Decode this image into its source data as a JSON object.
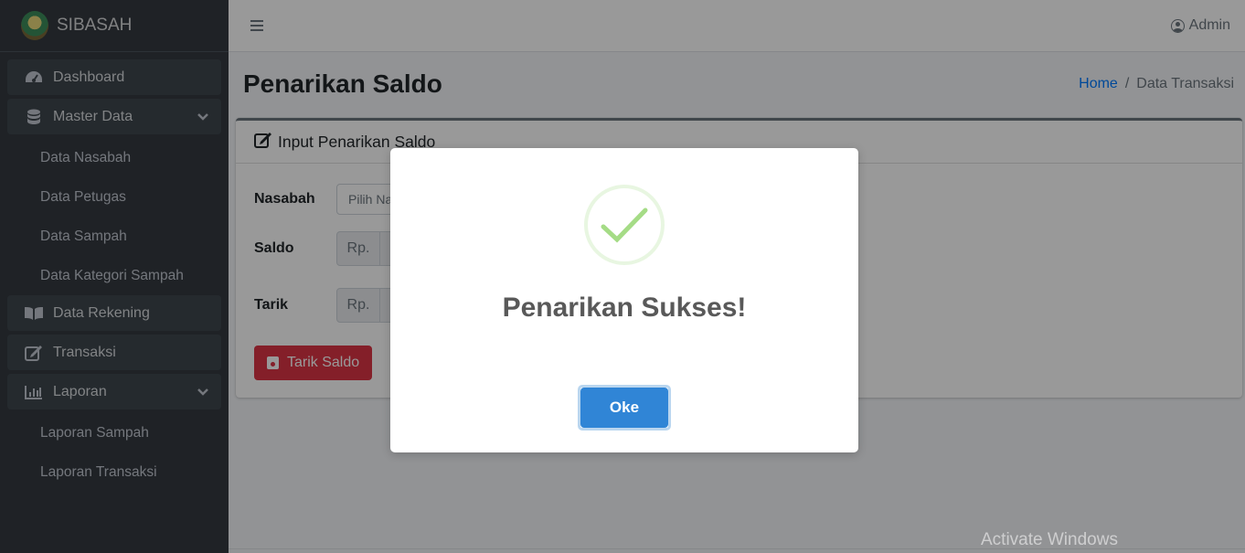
{
  "brand": {
    "name": "SIBASAH"
  },
  "sidebar": {
    "items": [
      {
        "label": "Dashboard",
        "icon": "tachometer-icon"
      },
      {
        "label": "Master Data",
        "icon": "database-icon",
        "expanded": true,
        "children": [
          "Data Nasabah",
          "Data Petugas",
          "Data Sampah",
          "Data Kategori Sampah"
        ]
      },
      {
        "label": "Data Rekening",
        "icon": "book-icon"
      },
      {
        "label": "Transaksi",
        "icon": "edit-icon"
      },
      {
        "label": "Laporan",
        "icon": "chart-icon",
        "expanded": true,
        "children": [
          "Laporan Sampah",
          "Laporan Transaksi"
        ]
      }
    ]
  },
  "header": {
    "user": "Admin"
  },
  "page": {
    "title": "Penarikan Saldo",
    "breadcrumb": {
      "home": "Home",
      "separator": "/",
      "current": "Data Transaksi"
    }
  },
  "card": {
    "title": "Input Penarikan Saldo",
    "nasabah": {
      "label": "Nasabah",
      "placeholder": "Pilih Na"
    },
    "saldo": {
      "label": "Saldo",
      "prefix": "Rp."
    },
    "tarik": {
      "label": "Tarik",
      "prefix": "Rp."
    },
    "submit_label": "Tarik Saldo"
  },
  "modal": {
    "title": "Penarikan Sukses!",
    "ok_label": "Oke",
    "icon": "success-check-icon",
    "accent": "#a5dc86",
    "button_color": "#3085d6"
  },
  "watermark": "Activate Windows"
}
